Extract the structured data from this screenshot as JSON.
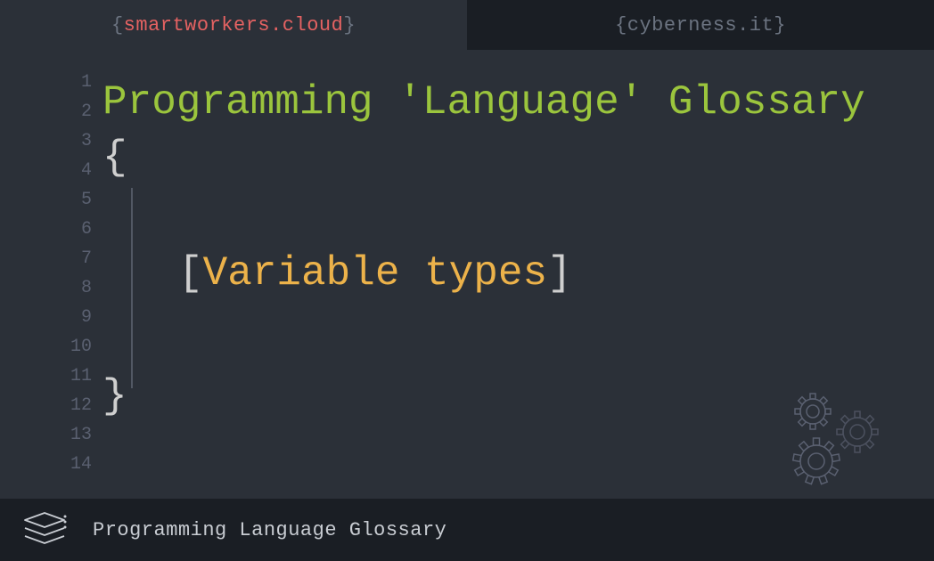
{
  "tabs": {
    "left": {
      "text": "smartworkers.cloud"
    },
    "right": {
      "text": "cyberness.it"
    }
  },
  "lineNumbers": [
    "1",
    "2",
    "3",
    "4",
    "5",
    "6",
    "7",
    "8",
    "9",
    "10",
    "11",
    "12",
    "13",
    "14"
  ],
  "editor": {
    "title": "Programming 'Language' Glossary",
    "openBrace": "{",
    "closeBrace": "}",
    "subtitle": {
      "leftBracket": "[",
      "text": "Variable types",
      "rightBracket": "]"
    }
  },
  "footer": {
    "text": "Programming Language Glossary"
  }
}
